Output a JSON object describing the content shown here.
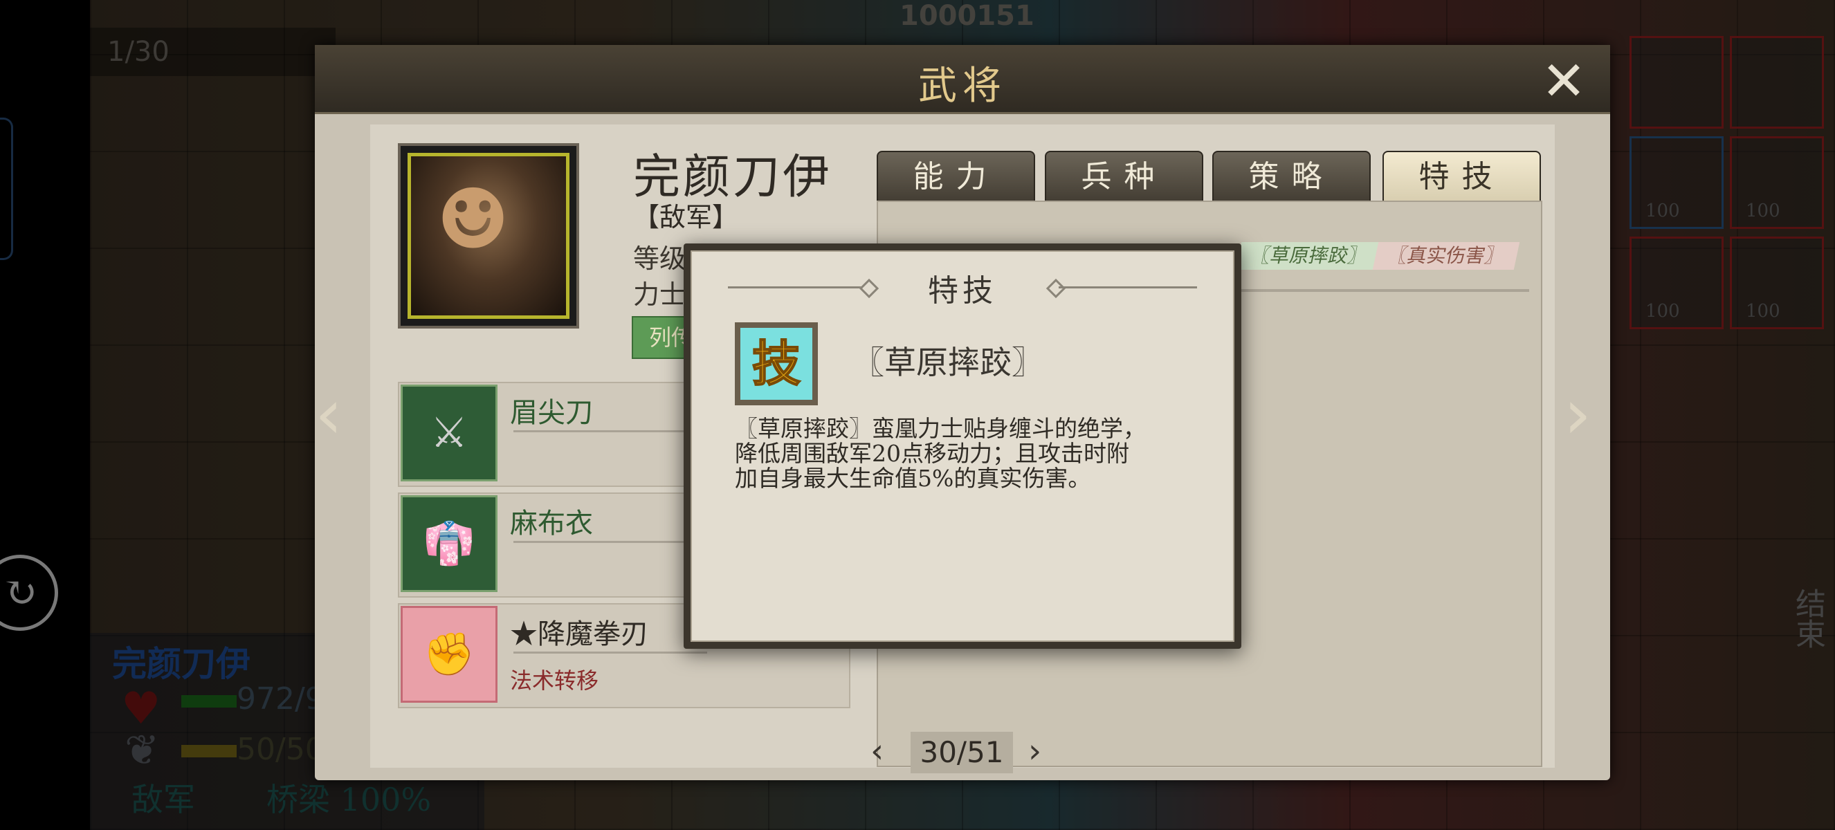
{
  "background": {
    "turn_counter": "1/30",
    "score": "1000151",
    "unit_status": {
      "name": "完颜刀伊",
      "hp_text": "972/9",
      "mp_text": "50/50",
      "faction": "敌军",
      "terrain": "桥梁 100%"
    },
    "unit_grid_labels": [
      "100",
      "100",
      "100",
      "100"
    ],
    "end_turn_label": "结束"
  },
  "modal": {
    "title": "武将",
    "close_icon": "close-icon"
  },
  "hero": {
    "name": "完颜刀伊",
    "faction": "【敌军】",
    "level_label": "等级",
    "class_label": "力士",
    "ability_button": "列传"
  },
  "equipment": [
    {
      "name": "眉尖刀",
      "sub": "",
      "icon": "glaive-icon"
    },
    {
      "name": "麻布衣",
      "sub": "",
      "icon": "robe-icon"
    },
    {
      "name": "★降魔拳刃",
      "sub": "法术转移",
      "icon": "fist-blade-icon"
    }
  ],
  "tabs": [
    {
      "label": "能力",
      "active": false
    },
    {
      "label": "兵种",
      "active": false
    },
    {
      "label": "策略",
      "active": false
    },
    {
      "label": "特技",
      "active": true
    }
  ],
  "skill_tags": [
    "〖草原摔跤〗",
    "〖真实伤害〗"
  ],
  "pager": {
    "text": "30/51"
  },
  "popup": {
    "title": "特技",
    "icon_char": "技",
    "skill_name": "〖草原摔跤〗",
    "description": "〖草原摔跤〗蛮凰力士贴身缠斗的绝学，\n降低周围敌军20点移动力；且攻击时附\n加自身最大生命值5%的真实伤害。"
  },
  "colors": {
    "accent_gold": "#e2c98c",
    "skill_icon_bg": "#7be0df",
    "tab_active": "#f3ead0"
  }
}
